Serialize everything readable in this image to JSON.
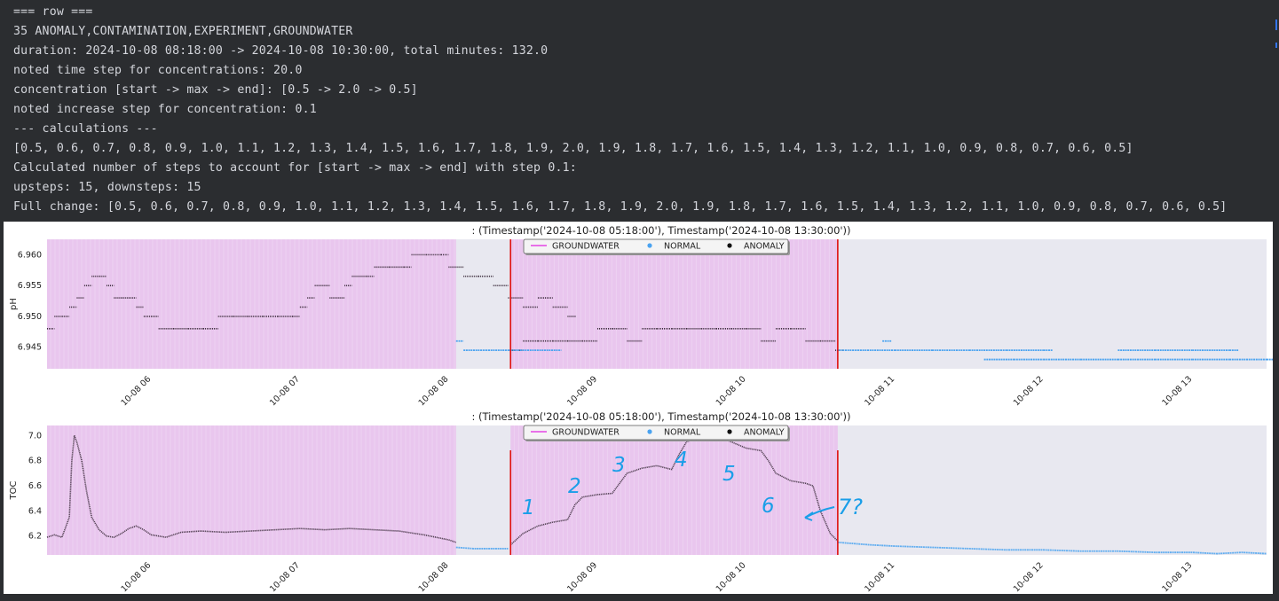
{
  "console": {
    "lines": [
      "=== row ===",
      "35 ANOMALY,CONTAMINATION,EXPERIMENT,GROUNDWATER",
      "duration: 2024-10-08 08:18:00 -> 2024-10-08 10:30:00, total minutes: 132.0",
      "noted time step for concentrations: 20.0",
      "concentration [start -> max -> end]: [0.5 -> 2.0 -> 0.5]",
      "noted increase step for concentration: 0.1",
      "--- calculations ---",
      "[0.5, 0.6, 0.7, 0.8, 0.9, 1.0, 1.1, 1.2, 1.3, 1.4, 1.5, 1.6, 1.7, 1.8, 1.9, 2.0, 1.9, 1.8, 1.7, 1.6, 1.5, 1.4, 1.3, 1.2, 1.1, 1.0, 0.9, 0.8, 0.7, 0.6, 0.5]",
      "Calculated number of steps to account for [start -> max -> end] with step 0.1:",
      "upsteps: 15, downsteps: 15",
      "Full change: [0.5, 0.6, 0.7, 0.8, 0.9, 1.0, 1.1, 1.2, 1.3, 1.4, 1.5, 1.6, 1.7, 1.8, 1.9, 2.0, 1.9, 1.8, 1.7, 1.6, 1.5, 1.4, 1.3, 1.2, 1.1, 1.0, 0.9, 0.8, 0.7, 0.6, 0.5]"
    ]
  },
  "colors": {
    "background": "#2b2d30",
    "console_text": "#d4d6dc",
    "plot_bg": "#e8e8f0",
    "highlight": "#e9c6ee",
    "anomaly": "#3a2a3a",
    "normal": "#4aa3f0",
    "marker_line": "#e01010",
    "legend_line": "#e020e0",
    "annotation": "#1a9ee8"
  },
  "chart_data": [
    {
      "type": "scatter",
      "title": ": (Timestamp('2024-10-08 05:18:00'), Timestamp('2024-10-08 13:30:00'))",
      "ylabel": "pH",
      "xlim": [
        "2024-10-08 05:18",
        "2024-10-08 13:30"
      ],
      "ylim": [
        6.9415,
        6.9625
      ],
      "yticks": [
        "6.945",
        "6.950",
        "6.955",
        "6.960"
      ],
      "xticks": [
        "10-08 06",
        "10-08 07",
        "10-08 08",
        "10-08 09",
        "10-08 10",
        "10-08 11",
        "10-08 12",
        "10-08 13"
      ],
      "legend": [
        "GROUNDWATER",
        "NORMAL",
        "ANOMALY"
      ],
      "legend_position": "top-center",
      "shaded_spans": [
        [
          "2024-10-08 05:18",
          "2024-10-08 08:03"
        ],
        [
          "2024-10-08 08:25",
          "2024-10-08 10:37"
        ]
      ],
      "vlines": [
        "2024-10-08 08:25",
        "2024-10-08 10:37"
      ],
      "series": [
        {
          "name": "ANOMALY",
          "points": [
            [
              "05:18",
              6.948
            ],
            [
              "05:21",
              6.95
            ],
            [
              "05:24",
              6.95
            ],
            [
              "05:27",
              6.9515
            ],
            [
              "05:30",
              6.953
            ],
            [
              "05:33",
              6.955
            ],
            [
              "05:36",
              6.9565
            ],
            [
              "05:39",
              6.9565
            ],
            [
              "05:42",
              6.955
            ],
            [
              "05:45",
              6.953
            ],
            [
              "05:48",
              6.953
            ],
            [
              "05:51",
              6.953
            ],
            [
              "05:54",
              6.9515
            ],
            [
              "05:57",
              6.95
            ],
            [
              "06:00",
              6.95
            ],
            [
              "06:03",
              6.948
            ],
            [
              "06:09",
              6.948
            ],
            [
              "06:15",
              6.948
            ],
            [
              "06:21",
              6.948
            ],
            [
              "06:27",
              6.95
            ],
            [
              "06:33",
              6.95
            ],
            [
              "06:39",
              6.95
            ],
            [
              "06:45",
              6.95
            ],
            [
              "06:51",
              6.95
            ],
            [
              "06:57",
              6.95
            ],
            [
              "07:00",
              6.9515
            ],
            [
              "07:03",
              6.953
            ],
            [
              "07:06",
              6.955
            ],
            [
              "07:12",
              6.953
            ],
            [
              "07:18",
              6.955
            ],
            [
              "07:21",
              6.9565
            ],
            [
              "07:27",
              6.9565
            ],
            [
              "07:30",
              6.958
            ],
            [
              "07:36",
              6.958
            ],
            [
              "07:42",
              6.958
            ],
            [
              "07:45",
              6.96
            ],
            [
              "07:51",
              6.96
            ],
            [
              "07:57",
              6.96
            ],
            [
              "08:00",
              6.958
            ],
            [
              "08:06",
              6.9565
            ],
            [
              "08:12",
              6.9565
            ],
            [
              "08:18",
              6.955
            ],
            [
              "08:24",
              6.953
            ],
            [
              "08:30",
              6.9515
            ],
            [
              "08:36",
              6.953
            ],
            [
              "08:42",
              6.9515
            ],
            [
              "08:48",
              6.95
            ],
            [
              "08:25",
              6.9445
            ],
            [
              "08:30",
              6.946
            ],
            [
              "08:36",
              6.946
            ],
            [
              "08:42",
              6.946
            ],
            [
              "08:48",
              6.946
            ],
            [
              "08:54",
              6.946
            ],
            [
              "09:00",
              6.948
            ],
            [
              "09:06",
              6.948
            ],
            [
              "09:12",
              6.946
            ],
            [
              "09:18",
              6.948
            ],
            [
              "09:24",
              6.948
            ],
            [
              "09:30",
              6.948
            ],
            [
              "09:36",
              6.948
            ],
            [
              "09:42",
              6.948
            ],
            [
              "09:48",
              6.948
            ],
            [
              "09:54",
              6.948
            ],
            [
              "10:00",
              6.948
            ],
            [
              "10:06",
              6.946
            ],
            [
              "10:12",
              6.948
            ],
            [
              "10:18",
              6.948
            ],
            [
              "10:24",
              6.946
            ],
            [
              "10:30",
              6.946
            ],
            [
              "10:36",
              6.9445
            ]
          ]
        },
        {
          "name": "NORMAL",
          "points": [
            [
              "08:03",
              6.946
            ],
            [
              "08:06",
              6.9445
            ],
            [
              "08:15",
              6.9445
            ],
            [
              "08:24",
              6.9445
            ],
            [
              "10:37",
              6.9445
            ],
            [
              "10:45",
              6.9445
            ],
            [
              "11:00",
              6.9445
            ],
            [
              "11:15",
              6.9445
            ],
            [
              "11:30",
              6.9445
            ],
            [
              "11:45",
              6.9445
            ],
            [
              "12:00",
              6.9445
            ],
            [
              "11:36",
              6.943
            ],
            [
              "11:48",
              6.943
            ],
            [
              "12:00",
              6.943
            ],
            [
              "12:15",
              6.943
            ],
            [
              "12:30",
              6.943
            ],
            [
              "12:45",
              6.943
            ],
            [
              "13:00",
              6.943
            ],
            [
              "13:15",
              6.943
            ],
            [
              "13:30",
              6.943
            ],
            [
              "12:30",
              6.9445
            ],
            [
              "12:45",
              6.9445
            ],
            [
              "13:00",
              6.9445
            ],
            [
              "13:15",
              6.9445
            ],
            [
              "10:55",
              6.946
            ]
          ]
        }
      ]
    },
    {
      "type": "scatter",
      "title": ": (Timestamp('2024-10-08 05:18:00'), Timestamp('2024-10-08 13:30:00'))",
      "ylabel": "TOC",
      "xlim": [
        "2024-10-08 05:18",
        "2024-10-08 13:30"
      ],
      "ylim": [
        6.05,
        7.08
      ],
      "yticks": [
        "6.2",
        "6.4",
        "6.6",
        "6.8",
        "7.0"
      ],
      "xticks": [
        "10-08 06",
        "10-08 07",
        "10-08 08",
        "10-08 09",
        "10-08 10",
        "10-08 11",
        "10-08 12",
        "10-08 13"
      ],
      "legend": [
        "GROUNDWATER",
        "NORMAL",
        "ANOMALY"
      ],
      "legend_position": "top-center",
      "shaded_spans": [
        [
          "2024-10-08 05:18",
          "2024-10-08 08:03"
        ],
        [
          "2024-10-08 08:25",
          "2024-10-08 10:37"
        ]
      ],
      "vlines": [
        "2024-10-08 08:25",
        "2024-10-08 10:37"
      ],
      "series": [
        {
          "name": "ANOMALY",
          "points": [
            [
              "05:18",
              6.19
            ],
            [
              "05:21",
              6.21
            ],
            [
              "05:24",
              6.19
            ],
            [
              "05:27",
              6.35
            ],
            [
              "05:28",
              6.8
            ],
            [
              "05:29",
              7.0
            ],
            [
              "05:30",
              6.95
            ],
            [
              "05:32",
              6.8
            ],
            [
              "05:34",
              6.55
            ],
            [
              "05:36",
              6.35
            ],
            [
              "05:39",
              6.25
            ],
            [
              "05:42",
              6.2
            ],
            [
              "05:45",
              6.19
            ],
            [
              "05:48",
              6.22
            ],
            [
              "05:51",
              6.26
            ],
            [
              "05:54",
              6.28
            ],
            [
              "05:57",
              6.25
            ],
            [
              "06:00",
              6.21
            ],
            [
              "06:06",
              6.19
            ],
            [
              "06:12",
              6.23
            ],
            [
              "06:20",
              6.24
            ],
            [
              "06:30",
              6.23
            ],
            [
              "06:40",
              6.24
            ],
            [
              "06:50",
              6.25
            ],
            [
              "07:00",
              6.26
            ],
            [
              "07:10",
              6.25
            ],
            [
              "07:20",
              6.26
            ],
            [
              "07:30",
              6.25
            ],
            [
              "07:40",
              6.24
            ],
            [
              "07:50",
              6.21
            ],
            [
              "08:00",
              6.17
            ],
            [
              "08:03",
              6.15
            ],
            [
              "08:25",
              6.13
            ],
            [
              "08:30",
              6.22
            ],
            [
              "08:36",
              6.28
            ],
            [
              "08:42",
              6.31
            ],
            [
              "08:48",
              6.33
            ],
            [
              "08:51",
              6.45
            ],
            [
              "08:54",
              6.51
            ],
            [
              "09:00",
              6.53
            ],
            [
              "09:06",
              6.54
            ],
            [
              "09:09",
              6.62
            ],
            [
              "09:12",
              6.7
            ],
            [
              "09:18",
              6.74
            ],
            [
              "09:24",
              6.76
            ],
            [
              "09:30",
              6.73
            ],
            [
              "09:33",
              6.85
            ],
            [
              "09:36",
              6.95
            ],
            [
              "09:42",
              6.99
            ],
            [
              "09:48",
              7.0
            ],
            [
              "09:54",
              6.95
            ],
            [
              "10:00",
              6.9
            ],
            [
              "10:06",
              6.88
            ],
            [
              "10:09",
              6.8
            ],
            [
              "10:12",
              6.7
            ],
            [
              "10:18",
              6.64
            ],
            [
              "10:24",
              6.62
            ],
            [
              "10:27",
              6.6
            ],
            [
              "10:30",
              6.4
            ],
            [
              "10:34",
              6.22
            ],
            [
              "10:37",
              6.16
            ]
          ]
        },
        {
          "name": "NORMAL",
          "points": [
            [
              "08:03",
              6.11
            ],
            [
              "08:10",
              6.1
            ],
            [
              "08:18",
              6.1
            ],
            [
              "08:24",
              6.1
            ],
            [
              "10:37",
              6.15
            ],
            [
              "10:50",
              6.13
            ],
            [
              "11:00",
              6.12
            ],
            [
              "11:15",
              6.11
            ],
            [
              "11:30",
              6.1
            ],
            [
              "11:45",
              6.09
            ],
            [
              "12:00",
              6.09
            ],
            [
              "12:15",
              6.08
            ],
            [
              "12:30",
              6.08
            ],
            [
              "12:45",
              6.07
            ],
            [
              "13:00",
              6.07
            ],
            [
              "13:10",
              6.06
            ],
            [
              "13:20",
              6.07
            ],
            [
              "13:30",
              6.06
            ]
          ]
        }
      ],
      "annotations": [
        "1",
        "2",
        "3",
        "4",
        "5",
        "6",
        "7?"
      ]
    }
  ]
}
